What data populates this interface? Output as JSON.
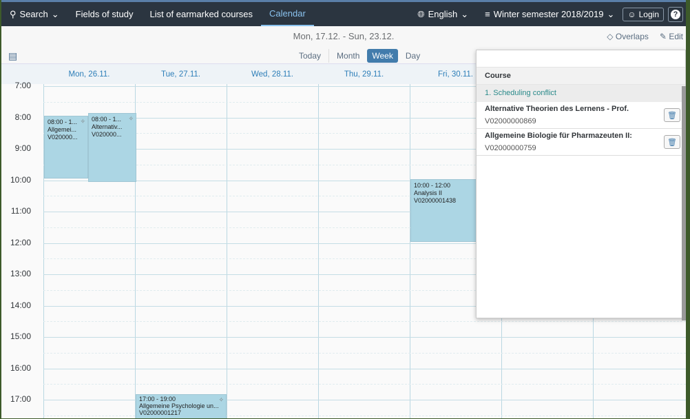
{
  "nav": {
    "search": "Search",
    "items": [
      "Fields of study",
      "List of earmarked courses",
      "Calendar"
    ],
    "language": "English",
    "semester": "Winter semester 2018/2019",
    "login": "Login",
    "help": "?"
  },
  "toolbar": {
    "range": "Mon, 17.12. - Sun, 23.12.",
    "overlaps": "Overlaps",
    "edit": "Edit",
    "today": "Today",
    "views": [
      "Month",
      "Week",
      "Day"
    ],
    "selected_view": "Week"
  },
  "days": [
    "Mon, 26.11.",
    "Tue, 27.11.",
    "Wed, 28.11.",
    "Thu, 29.11.",
    "Fri, 30.11.",
    "",
    ""
  ],
  "hours": [
    "7:00",
    "8:00",
    "9:00",
    "10:00",
    "11:00",
    "12:00",
    "13:00",
    "14:00",
    "15:00",
    "16:00",
    "17:00"
  ],
  "events": [
    {
      "time": "08:00 - 1...",
      "title": "Allgemei...",
      "code": "V020000..."
    },
    {
      "time": "08:00 - 1...",
      "title": "Alternativ...",
      "code": "V020000..."
    },
    {
      "time": "10:00 - 12:00",
      "title": "Analysis II",
      "code": "V02000001438"
    },
    {
      "time": "17:00 - 19:00",
      "title": "Allgemeine Psychologie un...",
      "code": "V02000001217"
    }
  ],
  "popover": {
    "header": "Course",
    "group": "1. Scheduling conflict",
    "rows": [
      {
        "title": "Alternative Theorien des Lernens - Prof.",
        "code": "V02000000869"
      },
      {
        "title": "Allgemeine Biologie für Pharmazeuten II:",
        "code": "V02000000759"
      }
    ]
  }
}
